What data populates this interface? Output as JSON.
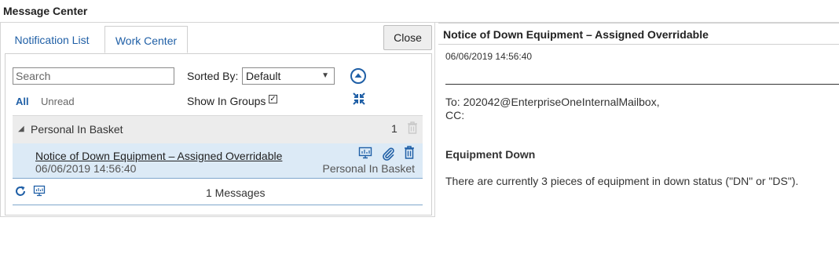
{
  "window": {
    "title": "Message Center"
  },
  "tabs": [
    {
      "label": "Notification List",
      "active": false
    },
    {
      "label": "Work Center",
      "active": true
    }
  ],
  "close_label": "Close",
  "search": {
    "placeholder": "Search",
    "value": ""
  },
  "sort": {
    "label": "Sorted By:",
    "selected": "Default"
  },
  "filters": {
    "all": "All",
    "unread": "Unread"
  },
  "show_in_groups": {
    "label": "Show In Groups",
    "checked": true
  },
  "group": {
    "name": "Personal In Basket",
    "count": "1"
  },
  "message": {
    "subject": "Notice of Down Equipment – Assigned Overridable",
    "date": "06/06/2019 14:56:40",
    "basket": "Personal In Basket"
  },
  "footer": {
    "count_text": "1 Messages"
  },
  "detail": {
    "title": "Notice of Down Equipment – Assigned Overridable",
    "date": "06/06/2019 14:56:40",
    "to": "To: 202042@EnterpriseOneInternalMailbox,",
    "cc": "CC:",
    "heading": "Equipment Down",
    "body": "There are currently 3 pieces of equipment in down status (\"DN\" or \"DS\")."
  },
  "icons": {
    "sort_up": "arrow-up-circle-icon",
    "collapse": "collapse-arrows-icon",
    "group_delete": "trash-icon",
    "monitor": "monitor-icon",
    "attachment": "paperclip-icon",
    "delete": "trash-icon",
    "refresh": "refresh-icon"
  },
  "colors": {
    "accent": "#1f5fa6",
    "row_selected": "#dceaf6",
    "group_header": "#ececec"
  }
}
